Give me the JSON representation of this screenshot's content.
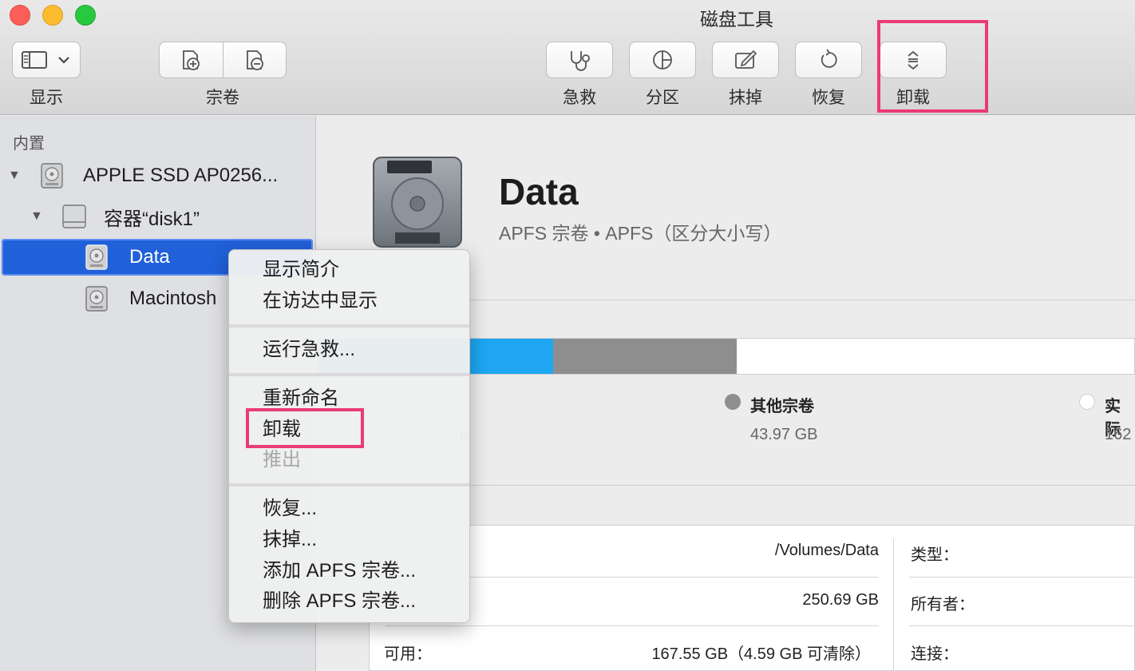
{
  "window": {
    "title": "磁盘工具"
  },
  "toolbar": {
    "view_label": "显示",
    "volume_label": "宗卷",
    "first_aid_label": "急救",
    "partition_label": "分区",
    "erase_label": "抹掉",
    "restore_label": "恢复",
    "unmount_label": "卸载"
  },
  "sidebar": {
    "section_header": "内置",
    "items": [
      {
        "label": "APPLE SSD AP0256...",
        "icon": "internal-disk-icon"
      },
      {
        "label": "容器“disk1”",
        "icon": "container-icon"
      },
      {
        "label": "Data",
        "icon": "volume-icon",
        "selected": true
      },
      {
        "label": "Macintosh",
        "icon": "volume-icon"
      }
    ]
  },
  "volume": {
    "name": "Data",
    "subtitle": "APFS 宗卷 • APFS（区分大小写）"
  },
  "usage": {
    "legend": [
      {
        "label": "其他宗卷",
        "value": "43.97 GB",
        "color": "#8e8e8e"
      },
      {
        "label": "实际",
        "value": "162",
        "color": "#ffffff"
      }
    ],
    "partial_value_left": "B",
    "colors": {
      "used": "#1ea6f2",
      "other": "#8e8e8e",
      "free": "#ffffff"
    }
  },
  "info": {
    "mount_point": "/Volumes/Data",
    "capacity": "250.69 GB",
    "available_label": "可用：",
    "available_value": "167.55 GB（4.59 GB 可清除）",
    "type_label": "类型：",
    "owners_label": "所有者：",
    "connection_label": "连接："
  },
  "context_menu": {
    "items": [
      {
        "label": "显示简介"
      },
      {
        "label": "在访达中显示"
      },
      {
        "label": "运行急救..."
      },
      {
        "label": "重新命名"
      },
      {
        "label": "卸载"
      },
      {
        "label": "推出",
        "disabled": true
      },
      {
        "label": "恢复..."
      },
      {
        "label": "抹掉..."
      },
      {
        "label": "添加 APFS 宗卷..."
      },
      {
        "label": "删除 APFS 宗卷..."
      }
    ]
  },
  "colors": {
    "accent": "#2060d9",
    "highlight": "#ea3a78"
  }
}
